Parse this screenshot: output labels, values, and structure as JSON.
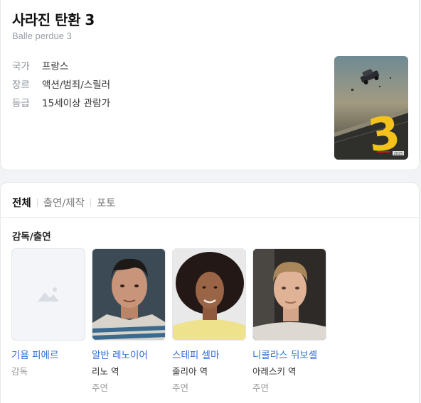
{
  "movie": {
    "title": "사라진 탄환 3",
    "original_title": "Balle perdue 3",
    "info": [
      {
        "key": "국가",
        "value": "프랑스"
      },
      {
        "key": "장르",
        "value": "액션/범죄/스릴러"
      },
      {
        "key": "등급",
        "value": "15세이상 관람가"
      }
    ],
    "poster": {
      "big_number": "3",
      "year_badge": "2025"
    }
  },
  "tabs": [
    "전체",
    "출연/제작",
    "포토"
  ],
  "section": {
    "title": "감독/출연"
  },
  "people": [
    {
      "name": "기욤 피에르",
      "role": "감독",
      "kind": ""
    },
    {
      "name": "알반 레노이어",
      "role": "리노 역",
      "kind": "주연"
    },
    {
      "name": "스테피 셀마",
      "role": "줄리아 역",
      "kind": "주연"
    },
    {
      "name": "니콜라스 뒤보셸",
      "role": "아레스키 역",
      "kind": "주연"
    }
  ],
  "colors": {
    "link": "#2f6fd1",
    "muted": "#8a9099",
    "accent_yellow": "#f3c21b"
  }
}
